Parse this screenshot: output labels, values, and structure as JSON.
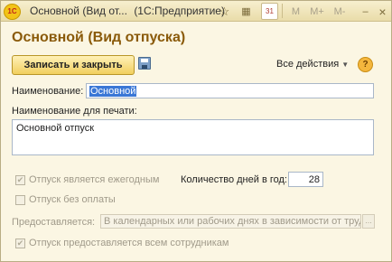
{
  "window": {
    "app_logo_text": "1C",
    "title": "Основной (Вид от...",
    "app_name": "(1С:Предприятие)",
    "buttons": {
      "favorite": "☆",
      "calc": "▦",
      "calendar": "31",
      "m": "M",
      "m_plus": "M+",
      "m_minus": "M-",
      "minimize": "–",
      "close": "×"
    }
  },
  "form": {
    "title": "Основной (Вид отпуска)",
    "toolbar": {
      "save_close_label": "Записать и закрыть",
      "all_actions_label": "Все действия",
      "help_label": "?"
    },
    "fields": {
      "name_label": "Наименование:",
      "name_value": "Основной",
      "print_name_label": "Наименование для печати:",
      "print_name_value": "Основной отпуск",
      "annual_label": "Отпуск является ежегодным",
      "annual_checked": true,
      "days_label": "Количество дней в год:",
      "days_value": "28",
      "unpaid_label": "Отпуск без оплаты",
      "unpaid_checked": false,
      "provided_label": "Предоставляется:",
      "provided_value": "В календарных или рабочих днях в зависимости от труд",
      "all_employees_label": "Отпуск предоставляется всем сотрудникам",
      "all_employees_checked": true
    }
  }
}
